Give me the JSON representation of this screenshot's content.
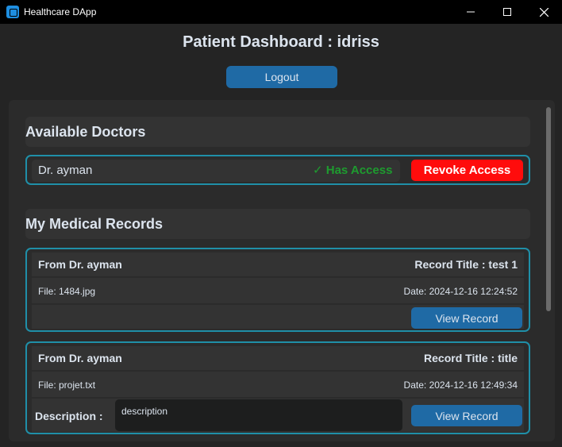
{
  "window": {
    "title": "Healthcare DApp",
    "minimize_glyph": "—",
    "maximize_glyph": "☐",
    "close_glyph": "✕"
  },
  "header": {
    "title": "Patient Dashboard : idriss",
    "logout_label": "Logout"
  },
  "doctors": {
    "section_title": "Available Doctors",
    "items": [
      {
        "name": "Dr. ayman",
        "status": "✓ Has Access",
        "action_label": "Revoke Access"
      }
    ]
  },
  "records": {
    "section_title": "My Medical Records",
    "items": [
      {
        "from": "From Dr. ayman",
        "title": "Record Title : test 1",
        "file": "File: 1484.jpg",
        "date": "Date: 2024-12-16 12:24:52",
        "view_label": "View Record"
      },
      {
        "from": "From Dr. ayman",
        "title": "Record Title : title",
        "file": "File: projet.txt",
        "date": "Date: 2024-12-16 12:49:34",
        "description_label": "Description :",
        "description": "description",
        "view_label": "View Record"
      }
    ]
  },
  "colors": {
    "accent": "#1f6aa5",
    "card_border": "#1f8fa8",
    "access_green": "#1e9b2f",
    "revoke_red": "#ff0c0c",
    "background": "#242424"
  }
}
